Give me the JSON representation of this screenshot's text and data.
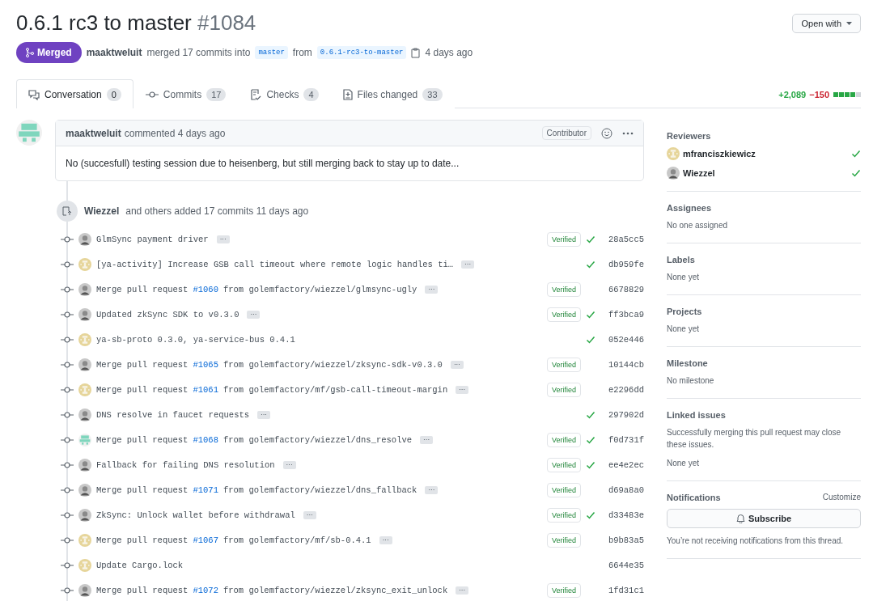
{
  "header": {
    "title": "0.6.1 rc3 to master",
    "number": "#1084",
    "open_with": "Open with"
  },
  "status": {
    "state": "Merged",
    "author": "maaktweluit",
    "text": "merged 17 commits into",
    "base": "master",
    "from": "from",
    "head": "0.6.1-rc3-to-master",
    "time": "4 days ago"
  },
  "tabs": [
    {
      "label": "Conversation",
      "count": "0",
      "selected": true
    },
    {
      "label": "Commits",
      "count": "17",
      "selected": false
    },
    {
      "label": "Checks",
      "count": "4",
      "selected": false
    },
    {
      "label": "Files changed",
      "count": "33",
      "selected": false
    }
  ],
  "diffstat": {
    "additions": "+2,089",
    "deletions": "−150",
    "level": 0.8
  },
  "comment": {
    "author": "maaktweluit",
    "meta": "commented 4 days ago",
    "role": "Contributor",
    "body": "No (succesfull) testing session due to heisenberg, but still merging back to stay up to date..."
  },
  "commit_group": {
    "author": "Wiezzel",
    "text": "and others added 17 commits 11 days ago"
  },
  "commits": [
    {
      "kind": "photo",
      "message": "GlmSync payment driver",
      "more": "···",
      "badge": "Verified",
      "passed": true,
      "sha": "28a5cc5"
    },
    {
      "kind": "identicon",
      "color": "#e6d59a",
      "message": "[ya-activity] Increase GSB call timeout where remote logic handles ti…",
      "more": "···",
      "passed": true,
      "sha": "db959fe"
    },
    {
      "kind": "photo",
      "message": "Merge pull request ",
      "pr": "#1060",
      "rest": " from golemfactory/wiezzel/glmsync-ugly",
      "more": "···",
      "badge": "Verified",
      "passed": false,
      "sha": "6678829"
    },
    {
      "kind": "photo",
      "message": "Updated zkSync SDK to v0.3.0",
      "more": "···",
      "badge": "Verified",
      "passed": true,
      "sha": "ff3bca9"
    },
    {
      "kind": "identicon",
      "color": "#e6d59a",
      "message": "ya-sb-proto 0.3.0, ya-service-bus 0.4.1",
      "passed": true,
      "sha": "052e446"
    },
    {
      "kind": "photo",
      "message": "Merge pull request ",
      "pr": "#1065",
      "rest": " from golemfactory/wiezzel/zksync-sdk-v0.3.0",
      "more": "···",
      "badge": "Verified",
      "passed": false,
      "sha": "10144cb"
    },
    {
      "kind": "identicon",
      "color": "#e6d59a",
      "message": "Merge pull request ",
      "pr": "#1061",
      "rest": " from golemfactory/mf/gsb-call-timeout-margin",
      "more": "···",
      "badge": "Verified",
      "passed": false,
      "sha": "e2296dd"
    },
    {
      "kind": "photo",
      "message": "DNS resolve in faucet requests",
      "more": "···",
      "passed": true,
      "sha": "297902d"
    },
    {
      "kind": "identicon",
      "color": "#7fd6bd",
      "message": "Merge pull request ",
      "pr": "#1068",
      "rest": " from golemfactory/wiezzel/dns_resolve",
      "more": "···",
      "badge": "Verified",
      "passed": true,
      "sha": "f0d731f"
    },
    {
      "kind": "photo",
      "message": "Fallback for failing DNS resolution",
      "more": "···",
      "badge": "Verified",
      "passed": true,
      "sha": "ee4e2ec"
    },
    {
      "kind": "photo",
      "message": "Merge pull request ",
      "pr": "#1071",
      "rest": " from golemfactory/wiezzel/dns_fallback",
      "more": "···",
      "badge": "Verified",
      "passed": false,
      "sha": "d69a8a0"
    },
    {
      "kind": "photo",
      "message": "ZkSync: Unlock wallet before withdrawal",
      "more": "···",
      "badge": "Verified",
      "passed": true,
      "sha": "d33483e"
    },
    {
      "kind": "identicon",
      "color": "#e6d59a",
      "message": "Merge pull request ",
      "pr": "#1067",
      "rest": " from golemfactory/mf/sb-0.4.1",
      "more": "···",
      "badge": "Verified",
      "passed": false,
      "sha": "b9b83a5"
    },
    {
      "kind": "identicon",
      "color": "#e6d59a",
      "message": "Update Cargo.lock",
      "passed": false,
      "sha": "6644e35"
    },
    {
      "kind": "photo",
      "message": "Merge pull request ",
      "pr": "#1072",
      "rest": " from golemfactory/wiezzel/zksync_exit_unlock",
      "more": "···",
      "badge": "Verified",
      "passed": false,
      "sha": "1fd31c1"
    }
  ],
  "sidebar": {
    "reviewers_title": "Reviewers",
    "reviewers": [
      {
        "name": "mfranciszkiewicz",
        "kind": "identicon",
        "color": "#e6d59a",
        "approved": true
      },
      {
        "name": "Wiezzel",
        "kind": "photo",
        "approved": true
      }
    ],
    "sections": [
      {
        "title": "Assignees",
        "lines": [
          "No one assigned"
        ]
      },
      {
        "title": "Labels",
        "lines": [
          "None yet"
        ]
      },
      {
        "title": "Projects",
        "lines": [
          "None yet"
        ]
      },
      {
        "title": "Milestone",
        "lines": [
          "No milestone"
        ]
      },
      {
        "title": "Linked issues",
        "lines": [
          "Successfully merging this pull request may close these issues.",
          "None yet"
        ]
      }
    ],
    "notifications": {
      "title": "Notifications",
      "customize": "Customize",
      "button": "Subscribe",
      "note": "You’re not receiving notifications from this thread."
    }
  }
}
